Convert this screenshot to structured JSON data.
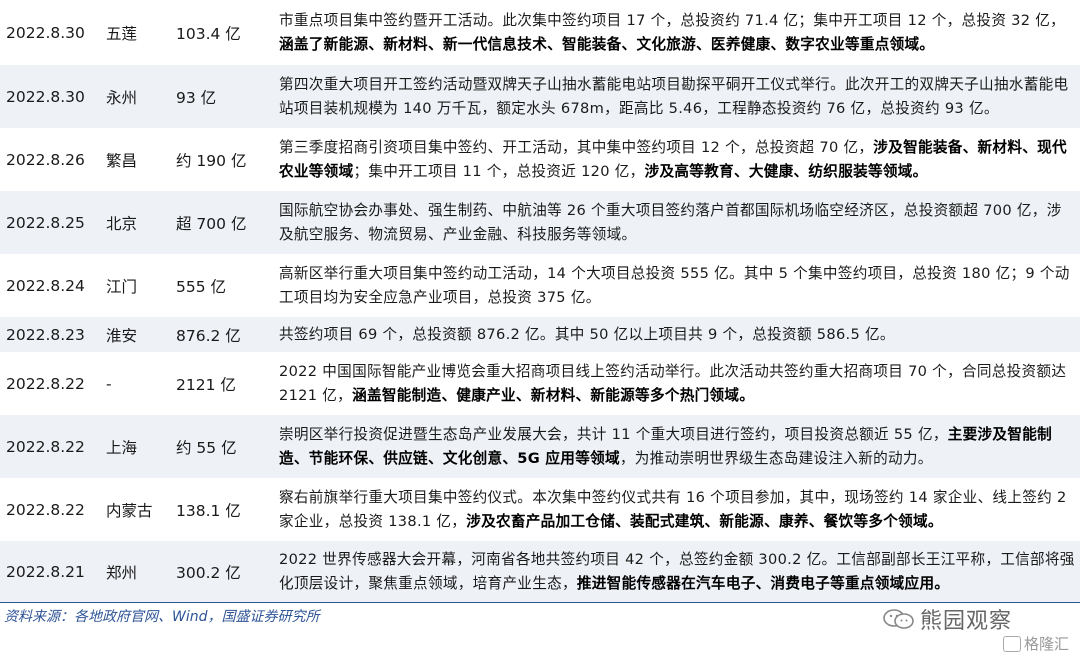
{
  "rows": [
    {
      "date": "2022.8.30",
      "city": "五莲",
      "amount": "103.4 亿",
      "segments": [
        {
          "t": "市重点项目集中签约暨开工活动。此次集中签约项目 17 个，总投资约 71.4 亿；集中开工项目 12 个，总投资 32 亿，",
          "b": false
        },
        {
          "t": "涵盖了新能源、新材料、新一代信息技术、智能装备、文化旅游、医养健康、数字农业等重点领域。",
          "b": true
        }
      ]
    },
    {
      "date": "2022.8.30",
      "city": "永州",
      "amount": "93 亿",
      "segments": [
        {
          "t": "第四次重大项目开工签约活动暨双牌天子山抽水蓄能电站项目勘探平硐开工仪式举行。此次开工的双牌天子山抽水蓄能电站项目装机规模为 140 万千瓦，额定水头 678m，距高比 5.46，工程静态投资约 76 亿，总投资约 93 亿。",
          "b": false
        }
      ]
    },
    {
      "date": "2022.8.26",
      "city": "繁昌",
      "amount": "约 190 亿",
      "segments": [
        {
          "t": "第三季度招商引资项目集中签约、开工活动，其中集中签约项目 12 个，总投资超 70 亿，",
          "b": false
        },
        {
          "t": "涉及智能装备、新材料、现代农业等领域",
          "b": true
        },
        {
          "t": "；集中开工项目 11 个，总投资近 120 亿，",
          "b": false
        },
        {
          "t": "涉及高等教育、大健康、纺织服装等领域。",
          "b": true
        }
      ]
    },
    {
      "date": "2022.8.25",
      "city": "北京",
      "amount": "超 700 亿",
      "segments": [
        {
          "t": "国际航空协会办事处、强生制药、中航油等 26 个重大项目签约落户首都国际机场临空经济区，总投资额超 700 亿，涉及航空服务、物流贸易、产业金融、科技服务等领域。",
          "b": false
        }
      ]
    },
    {
      "date": "2022.8.24",
      "city": "江门",
      "amount": "555 亿",
      "segments": [
        {
          "t": "高新区举行重大项目集中签约动工活动，14 个大项目总投资 555 亿。其中 5 个集中签约项目，总投资 180 亿；9 个动工项目均为安全应急产业项目，总投资 375 亿。",
          "b": false
        }
      ]
    },
    {
      "date": "2022.8.23",
      "city": "淮安",
      "amount": "876.2 亿",
      "segments": [
        {
          "t": "共签约项目 69 个，总投资额 876.2 亿。其中 50 亿以上项目共 9 个，总投资额 586.5 亿。",
          "b": false
        }
      ]
    },
    {
      "date": "2022.8.22",
      "city": "-",
      "amount": "2121 亿",
      "segments": [
        {
          "t": "2022 中国国际智能产业博览会重大招商项目线上签约活动举行。此次活动共签约重大招商项目 70 个，合同总投资额达 2121 亿，",
          "b": false
        },
        {
          "t": "涵盖智能制造、健康产业、新材料、新能源等多个热门领域。",
          "b": true
        }
      ]
    },
    {
      "date": "2022.8.22",
      "city": "上海",
      "amount": "约 55 亿",
      "segments": [
        {
          "t": "崇明区举行投资促进暨生态岛产业发展大会，共计 11 个重大项目进行签约，项目投资总额近 55 亿，",
          "b": false
        },
        {
          "t": "主要涉及智能制造、节能环保、供应链、文化创意、5G 应用等领域",
          "b": true
        },
        {
          "t": "，为推动崇明世界级生态岛建设注入新的动力。",
          "b": false
        }
      ]
    },
    {
      "date": "2022.8.22",
      "city": "内蒙古",
      "amount": "138.1 亿",
      "segments": [
        {
          "t": "察右前旗举行重大项目集中签约仪式。本次集中签约仪式共有 16 个项目参加，其中，现场签约 14 家企业、线上签约 2 家企业，总投资 138.1 亿，",
          "b": false
        },
        {
          "t": "涉及农畜产品加工仓储、装配式建筑、新能源、康养、餐饮等多个领域。",
          "b": true
        }
      ]
    },
    {
      "date": "2022.8.21",
      "city": "郑州",
      "amount": "300.2 亿",
      "segments": [
        {
          "t": "2022 世界传感器大会开幕，河南省各地共签约项目 42 个，总签约金额 300.2 亿。工信部副部长王江平称，工信部将强化顶层设计，聚焦重点领域，培育产业生态，",
          "b": false
        },
        {
          "t": "推进智能传感器在汽车电子、消费电子等重点领域应用。",
          "b": true
        }
      ]
    }
  ],
  "source_note": "资料来源：各地政府官网、Wind，国盛证券研究所",
  "watermarks": {
    "wechat_account": "熊园观察",
    "wechat_icon": "wechat-icon",
    "platform": "格隆汇",
    "platform_icon": "gelonghui-logo-icon"
  },
  "colors": {
    "row_shade": "#eef1f6",
    "rule_blue": "#2f5597",
    "source_text": "#2f5597"
  }
}
